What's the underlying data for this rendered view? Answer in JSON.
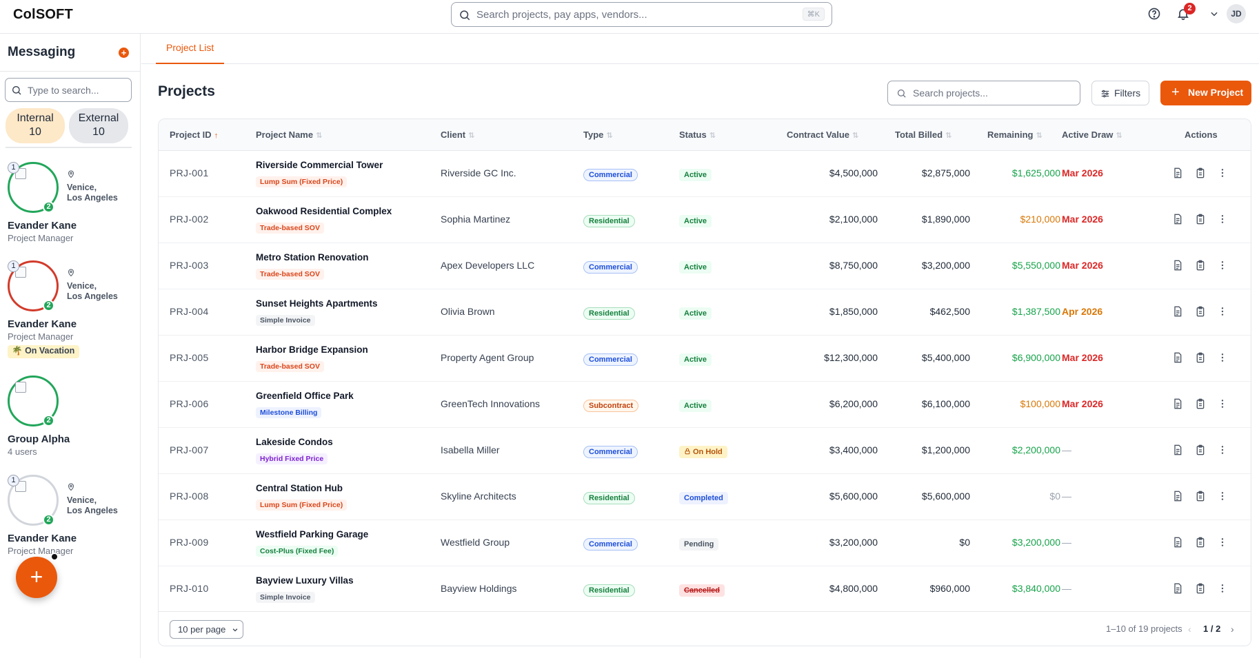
{
  "app": {
    "brand": "ColSOFT",
    "search_placeholder": "Search projects, pay apps, vendors...",
    "search_shortcut": "⌘K",
    "notification_count": "2",
    "user_initials": "JD"
  },
  "sidebar": {
    "title": "Messaging",
    "search_placeholder": "Type to search...",
    "segments": [
      {
        "label": "Internal",
        "count": "10"
      },
      {
        "label": "External",
        "count": "10"
      }
    ],
    "contacts": [
      {
        "name": "Evander Kane",
        "subtitle": "Project Manager",
        "location_line1": "Venice,",
        "location_line2": "Los Angeles",
        "top_count": "1",
        "bottom_count": "2",
        "ring": "green"
      },
      {
        "name": "Evander Kane",
        "subtitle": "Project Manager",
        "location_line1": "Venice,",
        "location_line2": "Los Angeles",
        "top_count": "1",
        "bottom_count": "2",
        "ring": "red",
        "status": "On Vacation",
        "status_icon": "🌴"
      },
      {
        "name": "Group Alpha",
        "subtitle": "4 users",
        "bottom_count": "2",
        "ring": "green"
      },
      {
        "name": "Evander Kane",
        "subtitle": "Project Manager",
        "location_line1": "Venice,",
        "location_line2": "Los Angeles",
        "top_count": "1",
        "bottom_count": "2",
        "ring": "grey"
      }
    ],
    "fab_label": "+"
  },
  "main": {
    "tab": "Project List",
    "title": "Projects",
    "search_placeholder": "Search projects...",
    "filters_label": "Filters",
    "new_project_label": "New Project",
    "columns": [
      "Project ID",
      "Project Name",
      "Client",
      "Type",
      "Status",
      "Contract Value",
      "Total Billed",
      "Remaining",
      "Active Draw",
      "Actions"
    ],
    "rows": [
      {
        "id": "PRJ-001",
        "name": "Riverside Commercial Tower",
        "billing": "Lump Sum (Fixed Price)",
        "billing_kind": "lump",
        "client": "Riverside GC Inc.",
        "type": "Commercial",
        "status": "Active",
        "contract": "$4,500,000",
        "billed": "$2,875,000",
        "remaining": "$1,625,000",
        "remaining_tone": "green",
        "draw": "Mar 2026",
        "draw_tone": "red"
      },
      {
        "id": "PRJ-002",
        "name": "Oakwood Residential Complex",
        "billing": "Trade-based SOV",
        "billing_kind": "trade",
        "client": "Sophia Martinez",
        "type": "Residential",
        "status": "Active",
        "contract": "$2,100,000",
        "billed": "$1,890,000",
        "remaining": "$210,000",
        "remaining_tone": "orange",
        "draw": "Mar 2026",
        "draw_tone": "red"
      },
      {
        "id": "PRJ-003",
        "name": "Metro Station Renovation",
        "billing": "Trade-based SOV",
        "billing_kind": "trade",
        "client": "Apex Developers LLC",
        "type": "Commercial",
        "status": "Active",
        "contract": "$8,750,000",
        "billed": "$3,200,000",
        "remaining": "$5,550,000",
        "remaining_tone": "green",
        "draw": "Mar 2026",
        "draw_tone": "red"
      },
      {
        "id": "PRJ-004",
        "name": "Sunset Heights Apartments",
        "billing": "Simple Invoice",
        "billing_kind": "simple",
        "client": "Olivia Brown",
        "type": "Residential",
        "status": "Active",
        "contract": "$1,850,000",
        "billed": "$462,500",
        "remaining": "$1,387,500",
        "remaining_tone": "green",
        "draw": "Apr 2026",
        "draw_tone": "orange"
      },
      {
        "id": "PRJ-005",
        "name": "Harbor Bridge Expansion",
        "billing": "Trade-based SOV",
        "billing_kind": "trade",
        "client": "Property Agent Group",
        "type": "Commercial",
        "status": "Active",
        "contract": "$12,300,000",
        "billed": "$5,400,000",
        "remaining": "$6,900,000",
        "remaining_tone": "green",
        "draw": "Mar 2026",
        "draw_tone": "red"
      },
      {
        "id": "PRJ-006",
        "name": "Greenfield Office Park",
        "billing": "Milestone Billing",
        "billing_kind": "milestone",
        "client": "GreenTech Innovations",
        "type": "Subcontract",
        "status": "Active",
        "contract": "$6,200,000",
        "billed": "$6,100,000",
        "remaining": "$100,000",
        "remaining_tone": "orange",
        "draw": "Mar 2026",
        "draw_tone": "red"
      },
      {
        "id": "PRJ-007",
        "name": "Lakeside Condos",
        "billing": "Hybrid Fixed Price",
        "billing_kind": "hybrid",
        "client": "Isabella Miller",
        "type": "Commercial",
        "status": "On Hold",
        "contract": "$3,400,000",
        "billed": "$1,200,000",
        "remaining": "$2,200,000",
        "remaining_tone": "green",
        "draw": "—",
        "draw_tone": "muted"
      },
      {
        "id": "PRJ-008",
        "name": "Central Station Hub",
        "billing": "Lump Sum (Fixed Price)",
        "billing_kind": "lump",
        "client": "Skyline Architects",
        "type": "Residential",
        "status": "Completed",
        "contract": "$5,600,000",
        "billed": "$5,600,000",
        "remaining": "$0",
        "remaining_tone": "grey",
        "draw": "—",
        "draw_tone": "muted"
      },
      {
        "id": "PRJ-009",
        "name": "Westfield Parking Garage",
        "billing": "Cost-Plus (Fixed Fee)",
        "billing_kind": "cost",
        "client": "Westfield Group",
        "type": "Commercial",
        "status": "Pending",
        "contract": "$3,200,000",
        "billed": "$0",
        "remaining": "$3,200,000",
        "remaining_tone": "green",
        "draw": "—",
        "draw_tone": "muted"
      },
      {
        "id": "PRJ-010",
        "name": "Bayview Luxury Villas",
        "billing": "Simple Invoice",
        "billing_kind": "simple",
        "client": "Bayview Holdings",
        "type": "Residential",
        "status": "Cancelled",
        "contract": "$4,800,000",
        "billed": "$960,000",
        "remaining": "$3,840,000",
        "remaining_tone": "green",
        "draw": "—",
        "draw_tone": "muted"
      }
    ],
    "per_page": "10 per page",
    "range_text": "1–10 of 19 projects",
    "page_text": "1 / 2"
  },
  "colors": {
    "accent": "#ea580c",
    "green": "#16a34a",
    "orange": "#d97706",
    "red": "#dc2626"
  }
}
